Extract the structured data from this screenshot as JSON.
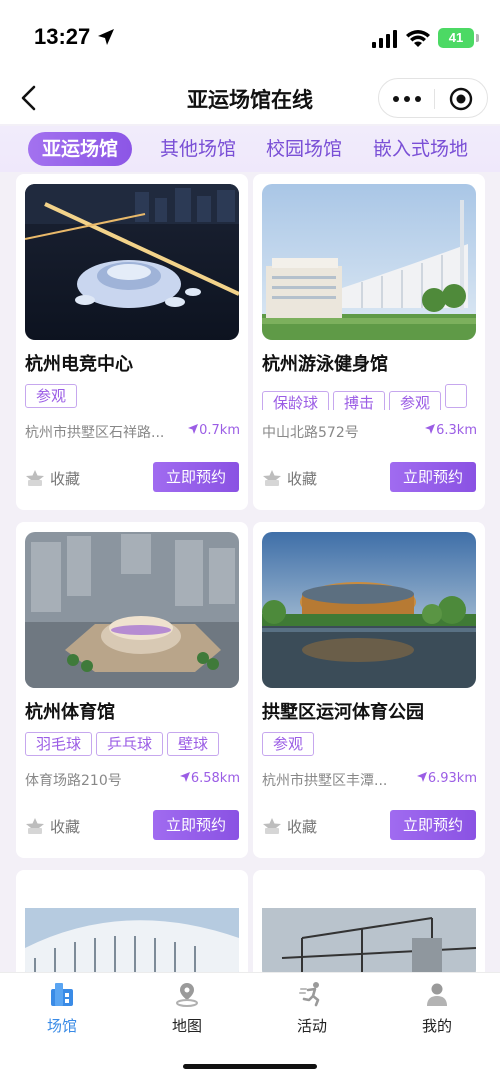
{
  "status_bar": {
    "time": "13:27",
    "battery": "41"
  },
  "nav": {
    "title": "亚运场馆在线"
  },
  "tabs": [
    {
      "label": "亚运场馆",
      "active": true
    },
    {
      "label": "其他场馆",
      "active": false
    },
    {
      "label": "校园场馆",
      "active": false
    },
    {
      "label": "嵌入式场地",
      "active": false
    }
  ],
  "venues": [
    {
      "name": "杭州电竞中心",
      "tags": [
        "参观"
      ],
      "address": "杭州市拱墅区石祥路...",
      "distance": "0.7km",
      "fav_label": "收藏",
      "book_label": "立即预约"
    },
    {
      "name": "杭州游泳健身馆",
      "tags": [
        "保龄球",
        "搏击",
        "参观",
        ""
      ],
      "address": "中山北路572号",
      "distance": "6.3km",
      "fav_label": "收藏",
      "book_label": "立即预约"
    },
    {
      "name": "杭州体育馆",
      "tags": [
        "羽毛球",
        "乒乓球",
        "壁球"
      ],
      "address": "体育场路210号",
      "distance": "6.58km",
      "fav_label": "收藏",
      "book_label": "立即预约"
    },
    {
      "name": "拱墅区运河体育公园",
      "tags": [
        "参观"
      ],
      "address": "杭州市拱墅区丰潭...",
      "distance": "6.93km",
      "fav_label": "收藏",
      "book_label": "立即预约"
    }
  ],
  "tabbar": [
    {
      "label": "场馆",
      "icon": "venue-icon",
      "active": true
    },
    {
      "label": "地图",
      "icon": "map-pin-icon",
      "active": false
    },
    {
      "label": "活动",
      "icon": "running-icon",
      "active": false
    },
    {
      "label": "我的",
      "icon": "user-icon",
      "active": false
    }
  ],
  "colors": {
    "accent": "#9b5de5",
    "tabbar_active": "#3a8be6",
    "background": "#f3f0f7"
  }
}
